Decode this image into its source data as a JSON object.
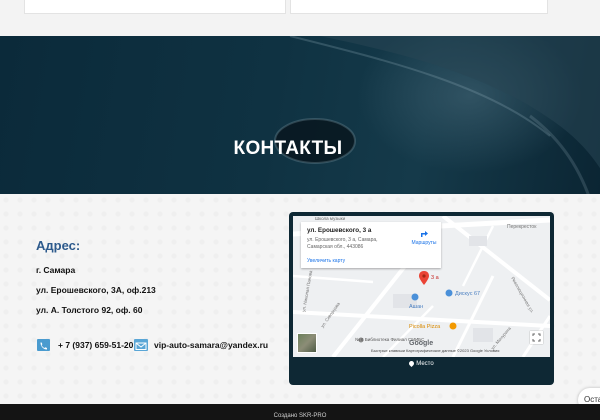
{
  "hero": {
    "title": "КОНТАКТЫ"
  },
  "contacts": {
    "address_heading": "Адрес:",
    "city": "г. Самара",
    "address_1": "ул. Ерошевского, 3А, оф.213",
    "address_2": "ул. А. Толстого 92, оф. 60",
    "phone": "+ 7 (937) 659-51-20",
    "email": "vip-auto-samara@yandex.ru",
    "phone_icon": "phone-icon",
    "email_icon": "envelope-icon"
  },
  "map": {
    "card_title": "ул. Ерошевского, 3 а",
    "card_address": "ул. Ерошевского, 3 а, Самара, Самарская обл., 443086",
    "enlarge_link": "Увеличить карту",
    "route_label": "Маршруты",
    "pin_label": "3 а",
    "poi_ashan": "Ашан",
    "poi_diskus": "Дискус 67",
    "poi_picolla": "Picolla Pizza",
    "poi_library": "№ 6 Библиотека Филиал СМИБС",
    "poi_music": "Школа музыки",
    "street_perekrestok": "Перекресток",
    "street_skvortsova": "ул. Скворцова",
    "street_lunach": "ул. Николая Панова",
    "street_ovrazhnaya": "ул. Мичурина",
    "street_magistralnaya": "Революционная ул.",
    "attribution": "Быстрые клавиши   Картографические данные ©2023 Google   Условия",
    "google_logo": "Google",
    "footer_label": "Место",
    "accent_color": "#ea4335"
  },
  "side_tab": {
    "label": "Оста"
  },
  "footer": {
    "text": "Создано SKR-PRO"
  }
}
